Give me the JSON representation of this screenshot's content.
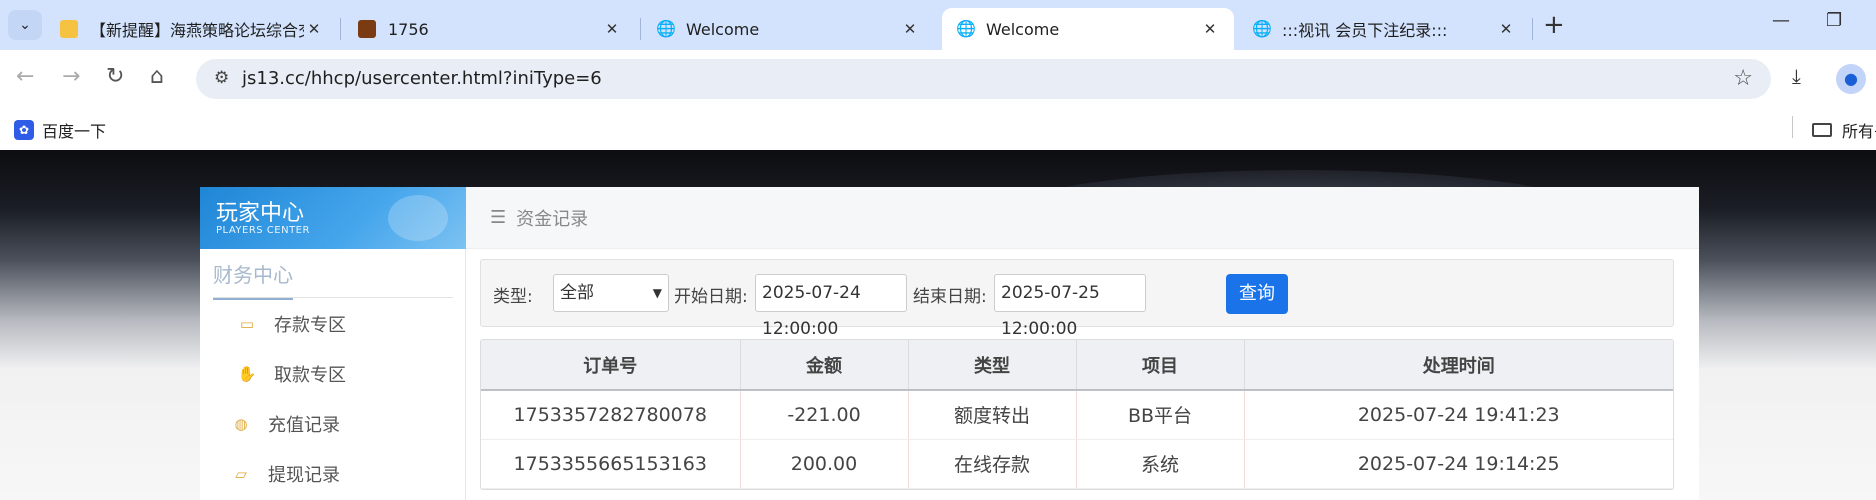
{
  "browser": {
    "tabs": [
      {
        "title": "【新提醒】海燕策略论坛综合交",
        "favicon": "yellow-badge",
        "active": false
      },
      {
        "title": "1756",
        "favicon": "game-badge",
        "active": false
      },
      {
        "title": "Welcome",
        "favicon": "globe",
        "active": false
      },
      {
        "title": "Welcome",
        "favicon": "globe",
        "active": true
      },
      {
        "title": ":::视讯 会员下注纪录:::",
        "favicon": "globe",
        "active": false
      }
    ],
    "url": "js13.cc/hhcp/usercenter.html?iniType=6",
    "bookmarks": [
      {
        "label": "百度一下",
        "icon": "paw"
      }
    ],
    "bookmarks_right": "所有书签"
  },
  "sidebar": {
    "logo_cn": "玩家中心",
    "logo_en": "PLAYERS CENTER",
    "section_title": "财务中心",
    "items": [
      {
        "label": "存款专区",
        "icon": "card-icon"
      },
      {
        "label": "取款专区",
        "icon": "hand-coin-icon"
      },
      {
        "label": "充值记录",
        "icon": "money-bag-icon"
      },
      {
        "label": "提现记录",
        "icon": "wallet-icon"
      }
    ]
  },
  "content": {
    "breadcrumb": "资金记录",
    "filter": {
      "type_label": "类型:",
      "type_value": "全部",
      "start_label": "开始日期:",
      "start_value": "2025-07-24 12:00:00",
      "end_label": "结束日期:",
      "end_value": "2025-07-25 12:00:00",
      "query_button": "查询"
    },
    "table": {
      "headers": [
        "订单号",
        "金额",
        "类型",
        "项目",
        "处理时间"
      ],
      "rows": [
        [
          "1753357282780078",
          "-221.00",
          "额度转出",
          "BB平台",
          "2025-07-24 19:41:23"
        ],
        [
          "1753355665153163",
          "200.00",
          "在线存款",
          "系统",
          "2025-07-24 19:14:25"
        ]
      ]
    }
  },
  "colors": {
    "accent": "#1a73e8",
    "logo_blue": "#1f86d6",
    "tab_strip": "#d3e3fd"
  }
}
